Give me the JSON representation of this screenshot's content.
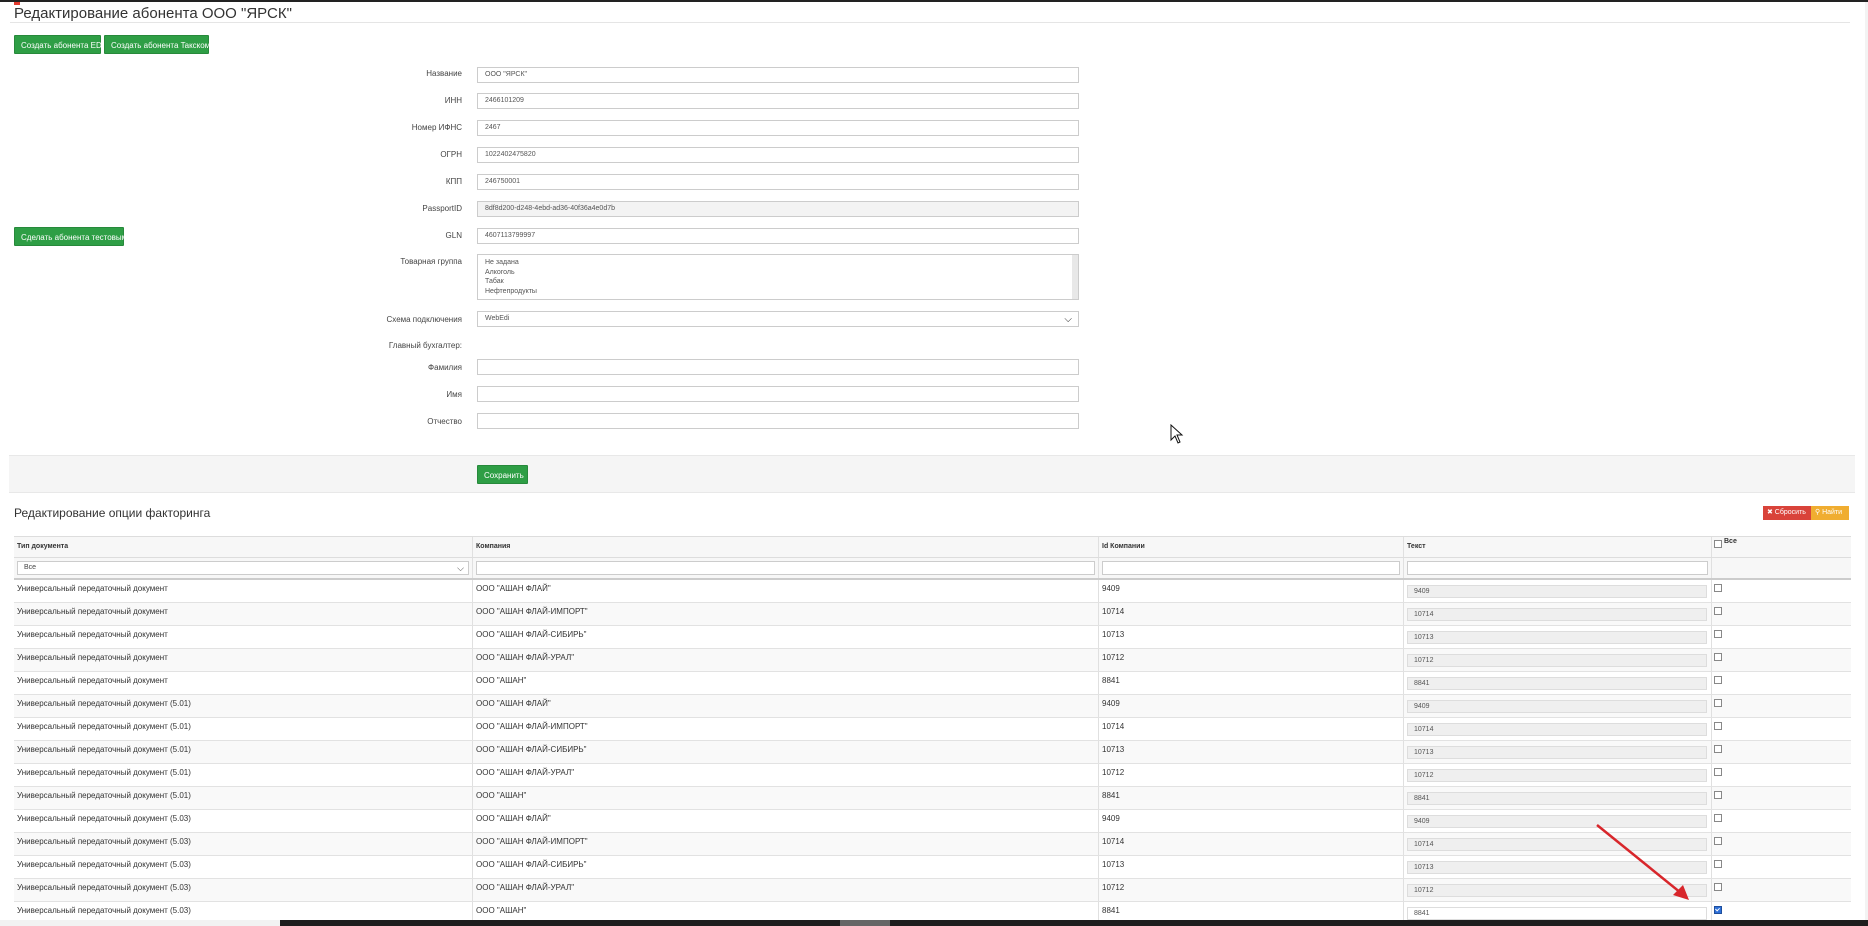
{
  "header": {
    "title": "Редактирование абонента ООО \"ЯРСК\""
  },
  "actions": {
    "create_edi": "Создать абонента EDI",
    "create_taxcom": "Создать абонента Taкском",
    "make_test": "Сделать абонента тестовым",
    "save": "Сохранить"
  },
  "form": {
    "name_label": "Название",
    "name_value": "ООО \"ЯРСК\"",
    "inn_label": "ИНН",
    "inn_value": "2466101209",
    "ifns_label": "Номер ИФНС",
    "ifns_value": "2467",
    "ogrn_label": "ОГРН",
    "ogrn_value": "1022402475820",
    "kpp_label": "КПП",
    "kpp_value": "246750001",
    "passport_label": "PassportID",
    "passport_value": "8df8d200-d248-4ebd-ad36-40f36a4e0d7b",
    "gln_label": "GLN",
    "gln_value": "4607113799997",
    "group_label": "Товарная группа",
    "group_options": [
      "Не задана",
      "Алкоголь",
      "Табак",
      "Нефтепродукты"
    ],
    "scheme_label": "Схема подключения",
    "scheme_value": "WebEdi",
    "accountant_label": "Главный бухгалтер:",
    "surname_label": "Фамилия",
    "surname_value": "",
    "firstname_label": "Имя",
    "firstname_value": "",
    "patronymic_label": "Отчество",
    "patronymic_value": ""
  },
  "factoring": {
    "title": "Редактирование опции факторинга",
    "reset_label": "✖ Сбросить",
    "find_label": "⚲ Найти",
    "columns": [
      "Тип документа",
      "Компания",
      "Id Компании",
      "Текст",
      "Все"
    ],
    "filter_doc_type": "Все",
    "rows": [
      {
        "doc": "Универсальный передаточный документ",
        "company": "ООО \"АШАН ФЛАЙ\"",
        "id": "9409",
        "text": "9409",
        "checked": false
      },
      {
        "doc": "Универсальный передаточный документ",
        "company": "ООО \"АШАН ФЛАЙ-ИМПОРТ\"",
        "id": "10714",
        "text": "10714",
        "checked": false
      },
      {
        "doc": "Универсальный передаточный документ",
        "company": "ООО \"АШАН ФЛАЙ-СИБИРЬ\"",
        "id": "10713",
        "text": "10713",
        "checked": false
      },
      {
        "doc": "Универсальный передаточный документ",
        "company": "ООО \"АШАН ФЛАЙ-УРАЛ\"",
        "id": "10712",
        "text": "10712",
        "checked": false
      },
      {
        "doc": "Универсальный передаточный документ",
        "company": "ООО \"АШАН\"",
        "id": "8841",
        "text": "8841",
        "checked": false
      },
      {
        "doc": "Универсальный передаточный документ (5.01)",
        "company": "ООО \"АШАН ФЛАЙ\"",
        "id": "9409",
        "text": "9409",
        "checked": false
      },
      {
        "doc": "Универсальный передаточный документ (5.01)",
        "company": "ООО \"АШАН ФЛАЙ-ИМПОРТ\"",
        "id": "10714",
        "text": "10714",
        "checked": false
      },
      {
        "doc": "Универсальный передаточный документ (5.01)",
        "company": "ООО \"АШАН ФЛАЙ-СИБИРЬ\"",
        "id": "10713",
        "text": "10713",
        "checked": false
      },
      {
        "doc": "Универсальный передаточный документ (5.01)",
        "company": "ООО \"АШАН ФЛАЙ-УРАЛ\"",
        "id": "10712",
        "text": "10712",
        "checked": false
      },
      {
        "doc": "Универсальный передаточный документ (5.01)",
        "company": "ООО \"АШАН\"",
        "id": "8841",
        "text": "8841",
        "checked": false
      },
      {
        "doc": "Универсальный передаточный документ (5.03)",
        "company": "ООО \"АШАН ФЛАЙ\"",
        "id": "9409",
        "text": "9409",
        "checked": false
      },
      {
        "doc": "Универсальный передаточный документ (5.03)",
        "company": "ООО \"АШАН ФЛАЙ-ИМПОРТ\"",
        "id": "10714",
        "text": "10714",
        "checked": false
      },
      {
        "doc": "Универсальный передаточный документ (5.03)",
        "company": "ООО \"АШАН ФЛАЙ-СИБИРЬ\"",
        "id": "10713",
        "text": "10713",
        "checked": false
      },
      {
        "doc": "Универсальный передаточный документ (5.03)",
        "company": "ООО \"АШАН ФЛАЙ-УРАЛ\"",
        "id": "10712",
        "text": "10712",
        "checked": false
      },
      {
        "doc": "Универсальный передаточный документ (5.03)",
        "company": "ООО \"АШАН\"",
        "id": "8841",
        "text": "8841",
        "checked": true
      }
    ]
  },
  "colors": {
    "primary_green": "#2e9e45",
    "danger_red": "#d9433a",
    "warning_yellow": "#f0ad30",
    "annotation_arrow": "#d8262b"
  },
  "icons": {
    "chevron": "chevron-down-icon",
    "cursor": "mouse-pointer-icon",
    "annotation": "red-arrow-annotation"
  }
}
